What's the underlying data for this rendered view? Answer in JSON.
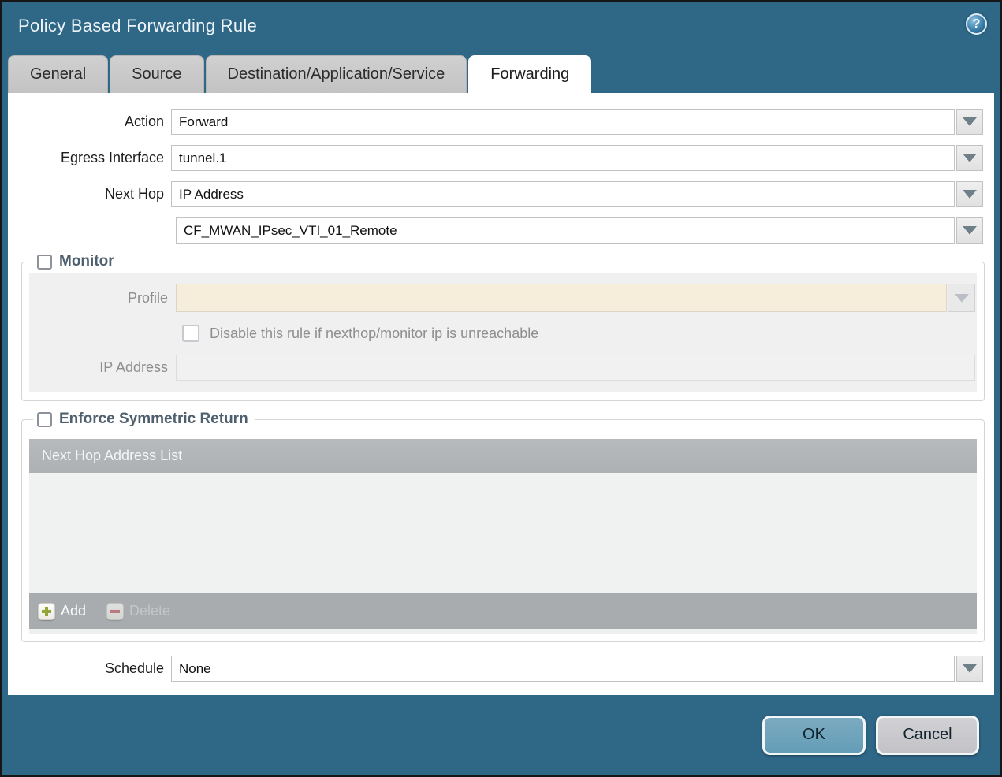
{
  "window": {
    "title": "Policy Based Forwarding Rule",
    "help_glyph": "?"
  },
  "tabs": [
    {
      "label": "General",
      "active": false
    },
    {
      "label": "Source",
      "active": false
    },
    {
      "label": "Destination/Application/Service",
      "active": false
    },
    {
      "label": "Forwarding",
      "active": true
    }
  ],
  "form": {
    "action": {
      "label": "Action",
      "value": "Forward"
    },
    "egress_interface": {
      "label": "Egress Interface",
      "value": "tunnel.1"
    },
    "next_hop": {
      "label": "Next Hop",
      "value": "IP Address"
    },
    "next_hop_address": {
      "value": "CF_MWAN_IPsec_VTI_01_Remote"
    },
    "schedule": {
      "label": "Schedule",
      "value": "None"
    }
  },
  "monitor": {
    "legend": "Monitor",
    "checked": false,
    "profile": {
      "label": "Profile",
      "value": ""
    },
    "disable_rule": {
      "label": "Disable this rule if nexthop/monitor ip is unreachable",
      "checked": false
    },
    "ip_address": {
      "label": "IP Address",
      "value": ""
    }
  },
  "symmetric_return": {
    "legend": "Enforce Symmetric Return",
    "checked": false,
    "table": {
      "header": "Next Hop Address List",
      "rows": []
    },
    "add_label": "Add",
    "delete_label": "Delete",
    "delete_enabled": false
  },
  "footer": {
    "ok_label": "OK",
    "cancel_label": "Cancel"
  },
  "colors": {
    "titlebar": "#2f6787",
    "tab_inactive": "#c6c6c6",
    "tab_active": "#ffffff",
    "legend_text": "#4e5f6d",
    "profile_field_bg": "#f6eeda",
    "table_header_bg": "#b2b5b8",
    "table_footer_bg": "#a8acaf",
    "add_plus": "#93a438",
    "delete_minus": "#c2606a",
    "ok_button": "#6fa3ba",
    "cancel_button": "#c9c9cd"
  }
}
